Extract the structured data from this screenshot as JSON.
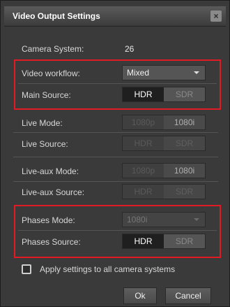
{
  "dialog": {
    "title": "Video Output Settings",
    "close_label": "×"
  },
  "camera_system": {
    "label": "Camera System:",
    "value": "26"
  },
  "video_workflow": {
    "label": "Video workflow:",
    "value": "Mixed"
  },
  "main_source": {
    "label": "Main Source:",
    "option_a": "HDR",
    "option_b": "SDR",
    "selected": "HDR"
  },
  "live_mode": {
    "label": "Live Mode:",
    "option_a": "1080p",
    "option_b": "1080i"
  },
  "live_source": {
    "label": "Live Source:",
    "option_a": "HDR",
    "option_b": "SDR"
  },
  "live_aux_mode": {
    "label": "Live-aux Mode:",
    "option_a": "1080p",
    "option_b": "1080i"
  },
  "live_aux_source": {
    "label": "Live-aux Source:",
    "option_a": "HDR",
    "option_b": "SDR"
  },
  "phases_mode": {
    "label": "Phases Mode:",
    "value": "1080i"
  },
  "phases_source": {
    "label": "Phases Source:",
    "option_a": "HDR",
    "option_b": "SDR",
    "selected": "HDR"
  },
  "apply_all": {
    "label": "Apply settings to all camera systems",
    "checked": false
  },
  "buttons": {
    "ok": "Ok",
    "cancel": "Cancel"
  },
  "colors": {
    "highlight": "#e01b24",
    "background": "#3a3a3a"
  }
}
